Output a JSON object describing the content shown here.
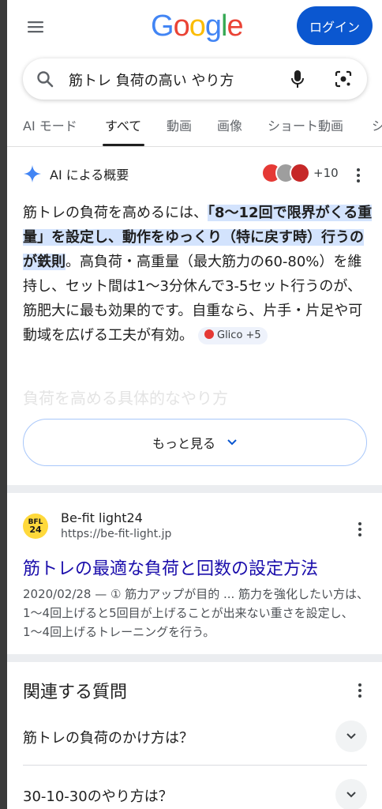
{
  "header": {
    "logo": [
      "G",
      "o",
      "o",
      "g",
      "l",
      "e"
    ],
    "logo_colors": [
      "#4285f4",
      "#ea4335",
      "#fbbc05",
      "#4285f4",
      "#34a853",
      "#ea4335"
    ],
    "login_label": "ログイン"
  },
  "search": {
    "query": "筋トレ 負荷の高い やり方"
  },
  "tabs": [
    {
      "label": "AI モード"
    },
    {
      "label": "すべて"
    },
    {
      "label": "動画"
    },
    {
      "label": "画像"
    },
    {
      "label": "ショート動画"
    },
    {
      "label": "シ"
    }
  ],
  "ai_overview": {
    "title": "AI による概要",
    "sources_more": "+10",
    "body_prefix": "筋トレの負荷を高めるには、",
    "body_highlight": "「8〜12回で限界がくる重量」を設定し、動作をゆっくり（特に戻す時）行うのが鉄則",
    "body_suffix": "。高負荷・高重量（最大筋力の60-80%）を維持し、セット間は1〜3分休んで3-5セット行うのが、筋肥大に最も効果的です。自重なら、片手・片足や可動域を広げる工夫が有効。",
    "chip_label": "Glico +5",
    "faded_heading": "負荷を高める具体的なやり方",
    "more_label": "もっと見る"
  },
  "result": {
    "favicon_top": "BFL",
    "favicon_bottom": "24",
    "site_name": "Be-fit light24",
    "url": "https://be-fit-light.jp",
    "title": "筋トレの最適な負荷と回数の設定方法",
    "snippet": "2020/02/28 — ① 筋力アップが目的 ... 筋力を強化したい方は、1〜4回上げると5回目が上げることが出来ない重さを設定し、1〜4回上げるトレーニングを行う。"
  },
  "paa": {
    "title": "関連する質問",
    "questions": [
      {
        "text": "筋トレの負荷のかけ方は？"
      },
      {
        "text": "30-10-30のやり方は？"
      }
    ]
  },
  "colors": {
    "accent": "#0b57d0",
    "link": "#1a0dab",
    "highlight": "#d3e3fd"
  }
}
